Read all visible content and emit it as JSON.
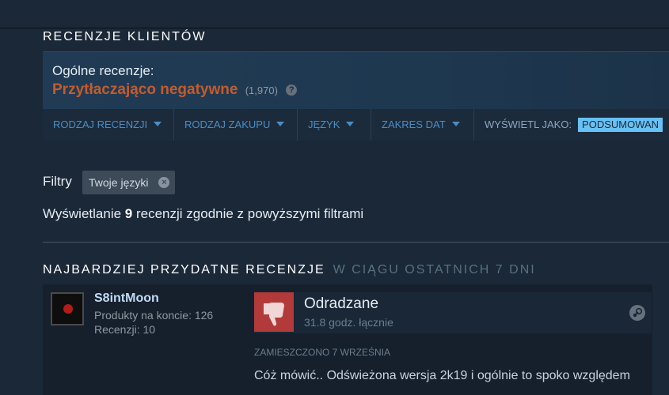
{
  "section": {
    "title": "RECENZJE KLIENTÓW"
  },
  "summary": {
    "label": "Ogólne recenzje:",
    "rating": "Przytłaczająco negatywne",
    "count": "(1,970)",
    "help_icon": "?"
  },
  "filterbar": {
    "review_type": "RODZAJ RECENZJI",
    "purchase_type": "RODZAJ ZAKUPU",
    "language": "JĘZYK",
    "date_range": "ZAKRES DAT",
    "display_as_label": "WYŚWIETL JAKO:",
    "display_as_value": "PODSUMOWAN"
  },
  "filters": {
    "label": "Filtry",
    "tag": "Twoje języki"
  },
  "showing": {
    "prefix": "Wyświetlanie",
    "count": "9",
    "suffix": "recenzji zgodnie z powyższymi filtrami"
  },
  "helpful": {
    "title": "NAJBARDZIEJ PRZYDATNE RECENZJE",
    "period": "W CIĄGU OSTATNICH 7 DNI"
  },
  "review": {
    "username": "S8intMoon",
    "products": "Produkty na koncie: 126",
    "reviews": "Recenzji: 10",
    "verdict": "Odradzane",
    "hours": "31.8 godz. łącznie",
    "posted": "ZAMIESZCZONO 7 WRZEŚNIA",
    "text": "Cóż mówić.. Odświeżona wersja 2k19 i ogólnie to spoko względem"
  },
  "colors": {
    "background": "#1b2838",
    "negative": "#c35c2c",
    "link": "#4c8cc2",
    "thumb_down": "#b23a3a"
  },
  "icons": [
    "help-icon",
    "caret-down-icon",
    "remove-filter-icon",
    "thumbs-down-icon",
    "steam-icon"
  ]
}
